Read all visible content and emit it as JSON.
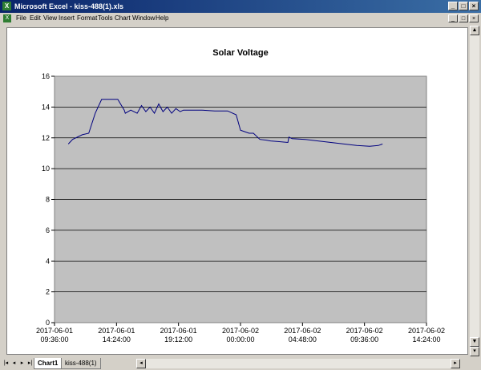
{
  "window": {
    "title": "Microsoft Excel - kiss-488(1).xls",
    "icon": "excel-icon"
  },
  "menu": [
    "File",
    "Edit",
    "View",
    "Insert",
    "Format",
    "Tools",
    "Chart",
    "Window",
    "Help"
  ],
  "tabs": [
    {
      "label": "Chart1",
      "active": true
    },
    {
      "label": "kiss-488(1)",
      "active": false
    }
  ],
  "colors": {
    "plot_bg": "#c0c0c0",
    "line": "#00007f",
    "titlebar": "#0a246a"
  },
  "chart_data": {
    "type": "line",
    "title": "Solar Voltage",
    "xlabel": "",
    "ylabel": "",
    "ylim": [
      0,
      16
    ],
    "yticks": [
      0,
      2,
      4,
      6,
      8,
      10,
      12,
      14,
      16
    ],
    "xlim": [
      "2017-06-01 09:36:00",
      "2017-06-02 14:24:00"
    ],
    "xticks": [
      {
        "date": "2017-06-01",
        "time": "09:36:00"
      },
      {
        "date": "2017-06-01",
        "time": "14:24:00"
      },
      {
        "date": "2017-06-01",
        "time": "19:12:00"
      },
      {
        "date": "2017-06-02",
        "time": "00:00:00"
      },
      {
        "date": "2017-06-02",
        "time": "04:48:00"
      },
      {
        "date": "2017-06-02",
        "time": "09:36:00"
      },
      {
        "date": "2017-06-02",
        "time": "14:24:00"
      }
    ],
    "grid": "horizontal",
    "series": [
      {
        "x": [
          "2017-06-01 10:40",
          "2017-06-01 11:00",
          "2017-06-01 11:45",
          "2017-06-01 12:15",
          "2017-06-01 12:45",
          "2017-06-01 13:15",
          "2017-06-01 13:45",
          "2017-06-01 14:30",
          "2017-06-01 15:00",
          "2017-06-01 15:05",
          "2017-06-01 15:30",
          "2017-06-01 16:00",
          "2017-06-01 16:20",
          "2017-06-01 16:40",
          "2017-06-01 17:00",
          "2017-06-01 17:20",
          "2017-06-01 17:40",
          "2017-06-01 18:00",
          "2017-06-01 18:20",
          "2017-06-01 18:40",
          "2017-06-01 19:00",
          "2017-06-01 19:20",
          "2017-06-01 19:35",
          "2017-06-01 20:00",
          "2017-06-01 21:00",
          "2017-06-01 22:00",
          "2017-06-01 23:00",
          "2017-06-01 23:40",
          "2017-06-02 00:00",
          "2017-06-02 00:20",
          "2017-06-02 00:40",
          "2017-06-02 01:00",
          "2017-06-02 01:30",
          "2017-06-02 02:00",
          "2017-06-02 02:20",
          "2017-06-02 03:00",
          "2017-06-02 03:40",
          "2017-06-02 03:45",
          "2017-06-02 04:00",
          "2017-06-02 05:00",
          "2017-06-02 06:00",
          "2017-06-02 07:00",
          "2017-06-02 08:00",
          "2017-06-02 09:00",
          "2017-06-02 10:00",
          "2017-06-02 10:40",
          "2017-06-02 11:00"
        ],
        "values": [
          11.6,
          11.9,
          12.2,
          12.3,
          13.6,
          14.5,
          14.5,
          14.5,
          13.8,
          13.6,
          13.8,
          13.6,
          14.1,
          13.7,
          14.0,
          13.6,
          14.2,
          13.7,
          14.0,
          13.6,
          13.9,
          13.7,
          13.8,
          13.8,
          13.8,
          13.75,
          13.75,
          13.5,
          12.5,
          12.4,
          12.3,
          12.3,
          11.9,
          11.85,
          11.8,
          11.75,
          11.7,
          12.05,
          11.95,
          11.9,
          11.8,
          11.7,
          11.6,
          11.5,
          11.45,
          11.5,
          11.6
        ]
      }
    ]
  }
}
